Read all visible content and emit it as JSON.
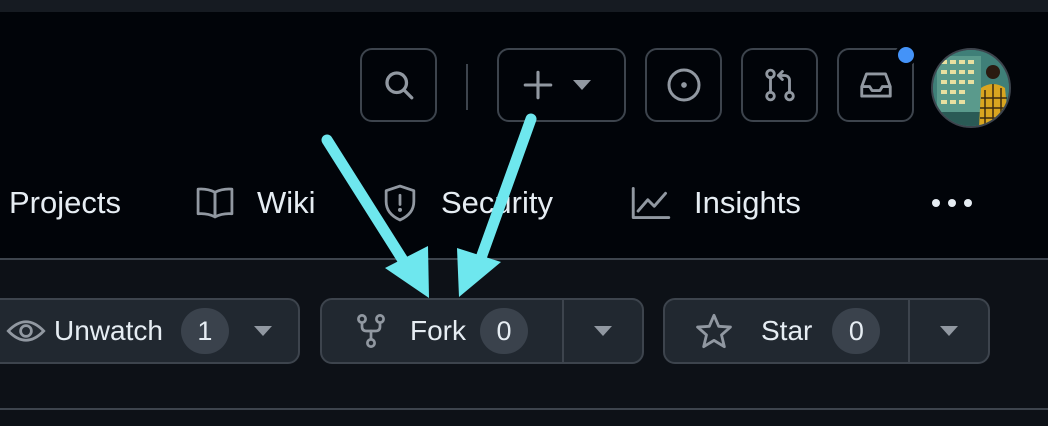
{
  "nav": {
    "items": [
      {
        "label": "Projects"
      },
      {
        "label": "Wiki"
      },
      {
        "label": "Security"
      },
      {
        "label": "Insights"
      }
    ]
  },
  "repo_actions": {
    "unwatch": {
      "label": "Unwatch",
      "count": "1"
    },
    "fork": {
      "label": "Fork",
      "count": "0"
    },
    "star": {
      "label": "Star",
      "count": "0"
    }
  },
  "colors": {
    "annotation_arrow": "#6ee7ee",
    "notification_dot": "#4493f8",
    "header_bg": "#010409",
    "page_bg": "#0d1117",
    "button_bg": "#212830",
    "border": "#3d444d"
  },
  "icons": {
    "search": "search-icon",
    "create": "plus-icon",
    "issues": "issue-opened-icon",
    "pulls": "git-pull-request-icon",
    "inbox": "inbox-icon",
    "wiki": "book-icon",
    "security": "shield-icon",
    "insights": "graph-icon",
    "more": "kebab-horizontal-icon",
    "watch": "eye-icon",
    "fork": "repo-forked-icon",
    "star": "star-icon"
  }
}
